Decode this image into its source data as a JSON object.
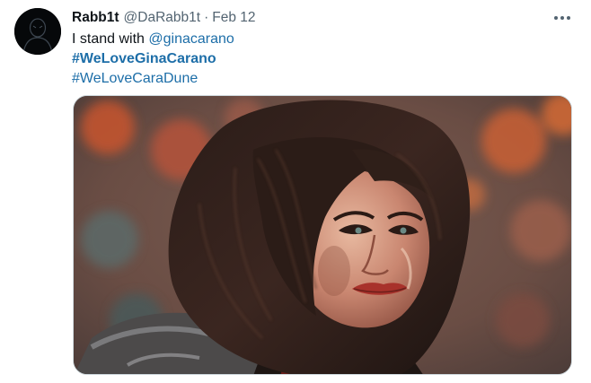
{
  "tweet": {
    "author": {
      "display_name": "Rabb1t",
      "handle": "@DaRabb1t",
      "avatar_icon": "dark-figure-avatar"
    },
    "separator": "·",
    "date": "Feb 12",
    "more_icon": "more-horizontal-icon",
    "text": {
      "prefix": "I stand with ",
      "mention": "@ginacarano",
      "hashtag_bold": "#WeLoveGinaCarano",
      "hashtag": "#WeLoveCaraDune"
    },
    "media": {
      "type": "painted portrait illustration",
      "palette": [
        "#8a5a45",
        "#c9603a",
        "#2b1d1a",
        "#d9a48a",
        "#3f4b4a"
      ]
    }
  },
  "colors": {
    "text": "#0f1419",
    "secondary": "#536471",
    "link": "#1d6ea8",
    "border": "#cfd9de"
  }
}
